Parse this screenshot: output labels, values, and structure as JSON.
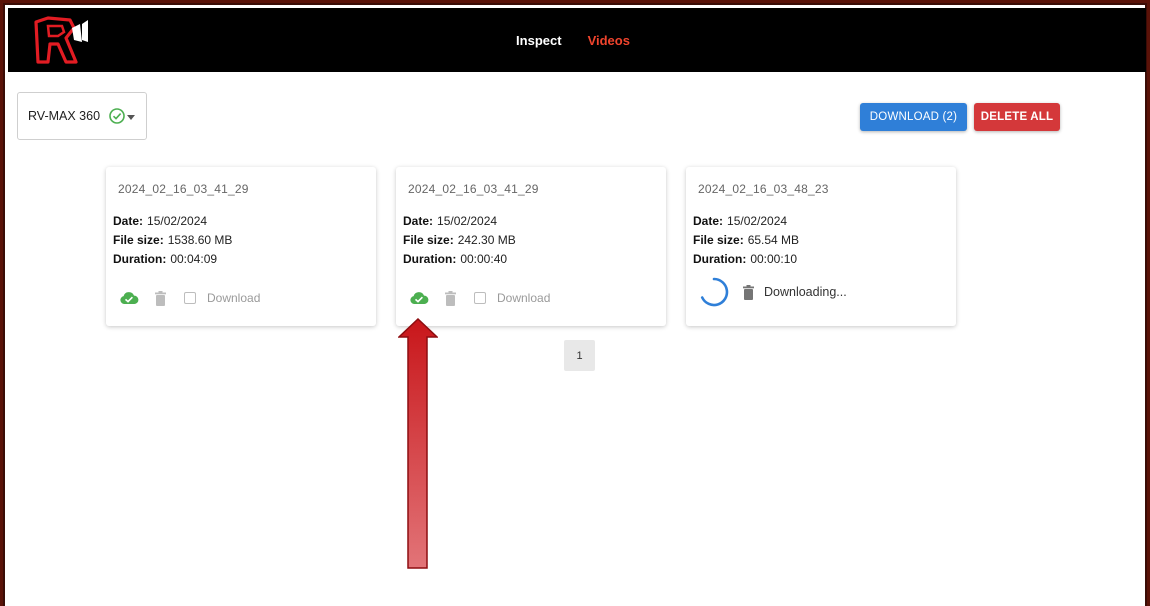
{
  "nav": {
    "inspect_label": "Inspect",
    "videos_label": "Videos"
  },
  "device_selector": {
    "value": "RV-MAX 360",
    "status_icon": "check-circle-icon"
  },
  "toolbar": {
    "download_label": "DOWNLOAD (2)",
    "delete_all_label": "DELETE ALL"
  },
  "labels": {
    "date": "Date:",
    "file_size": "File size:",
    "duration": "Duration:"
  },
  "videos": [
    {
      "name": "2024_02_16_03_41_29",
      "date": "15/02/2024",
      "file_size": "1538.60 MB",
      "duration": "00:04:09",
      "state": "downloaded",
      "checkbox_label": "Download"
    },
    {
      "name": "2024_02_16_03_41_29",
      "date": "15/02/2024",
      "file_size": "242.30 MB",
      "duration": "00:00:40",
      "state": "downloaded",
      "checkbox_label": "Download"
    },
    {
      "name": "2024_02_16_03_48_23",
      "date": "15/02/2024",
      "file_size": "65.54 MB",
      "duration": "00:00:10",
      "state": "downloading",
      "status_text": "Downloading..."
    }
  ],
  "pagination": {
    "current_page": "1"
  },
  "colors": {
    "topbar": "#000000",
    "nav_active": "#f0442d",
    "download_button": "#2f7fd8",
    "delete_button": "#d4383a",
    "cloud_ok": "#4caf50",
    "spinner": "#2f7fd8",
    "arrow": "#c8161a"
  }
}
